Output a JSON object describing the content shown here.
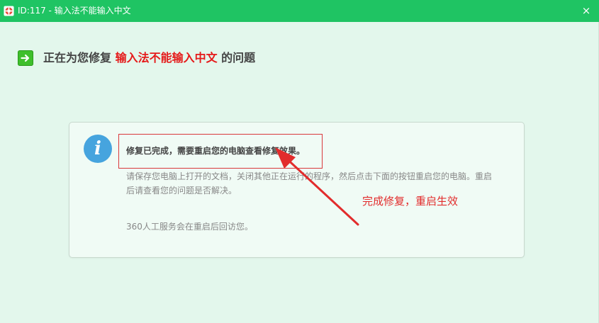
{
  "window": {
    "title": "ID:117 - 输入法不能输入中文",
    "close_label": "×"
  },
  "heading": {
    "prefix": "正在为您修复 ",
    "highlight": "输入法不能输入中文",
    "suffix": " 的问题"
  },
  "card": {
    "title": "修复已完成，需要重启您的电脑查看修复效果。",
    "description": "请保存您电脑上打开的文档，关闭其他正在运行的程序，然后点击下面的按钮重启您的电脑。重启后请查看您的问题是否解决。",
    "note": "360人工服务会在重启后回访您。"
  },
  "annotation": {
    "text": "完成修复，重启生效"
  },
  "colors": {
    "titlebar": "#1fc463",
    "background": "#e3f7ec",
    "highlight": "#e51b1b",
    "annotation": "#e22c2c",
    "info": "#46a4de"
  }
}
